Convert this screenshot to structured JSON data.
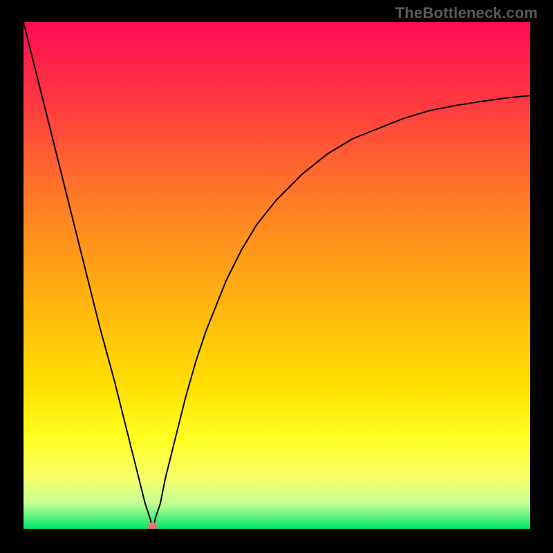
{
  "watermark": "TheBottleneck.com",
  "chart_data": {
    "type": "line",
    "title": "",
    "xlabel": "",
    "ylabel": "",
    "xlim": [
      0,
      100
    ],
    "ylim": [
      0,
      100
    ],
    "grid": false,
    "legend": false,
    "gradient_stops": [
      {
        "offset": 0.0,
        "color": "#ff0b53"
      },
      {
        "offset": 0.16,
        "color": "#ff3a3f"
      },
      {
        "offset": 0.35,
        "color": "#ff7b26"
      },
      {
        "offset": 0.55,
        "color": "#ffb30f"
      },
      {
        "offset": 0.72,
        "color": "#ffe000"
      },
      {
        "offset": 0.82,
        "color": "#ffff20"
      },
      {
        "offset": 0.9,
        "color": "#f6ff6a"
      },
      {
        "offset": 0.95,
        "color": "#c5ff95"
      },
      {
        "offset": 1.0,
        "color": "#00e56a"
      }
    ],
    "marker": {
      "x": 25.5,
      "y": 0.5,
      "color": "#d97b7b",
      "rx": 8,
      "ry": 6
    },
    "series": [
      {
        "name": "curve",
        "x": [
          0,
          3,
          6,
          9,
          12,
          15,
          18,
          21,
          23,
          24,
          25,
          25.5,
          26,
          27,
          28,
          30,
          32,
          34,
          36,
          38,
          40,
          43,
          46,
          50,
          55,
          60,
          65,
          70,
          75,
          80,
          85,
          90,
          95,
          100
        ],
        "y": [
          100,
          88,
          76,
          64,
          52,
          40,
          29,
          17,
          9,
          5,
          2,
          0,
          2,
          5,
          10,
          18,
          26,
          33,
          39,
          44,
          49,
          55,
          60,
          65,
          70,
          74,
          77,
          79,
          81,
          82.5,
          83.5,
          84.3,
          85,
          85.5
        ]
      }
    ]
  }
}
